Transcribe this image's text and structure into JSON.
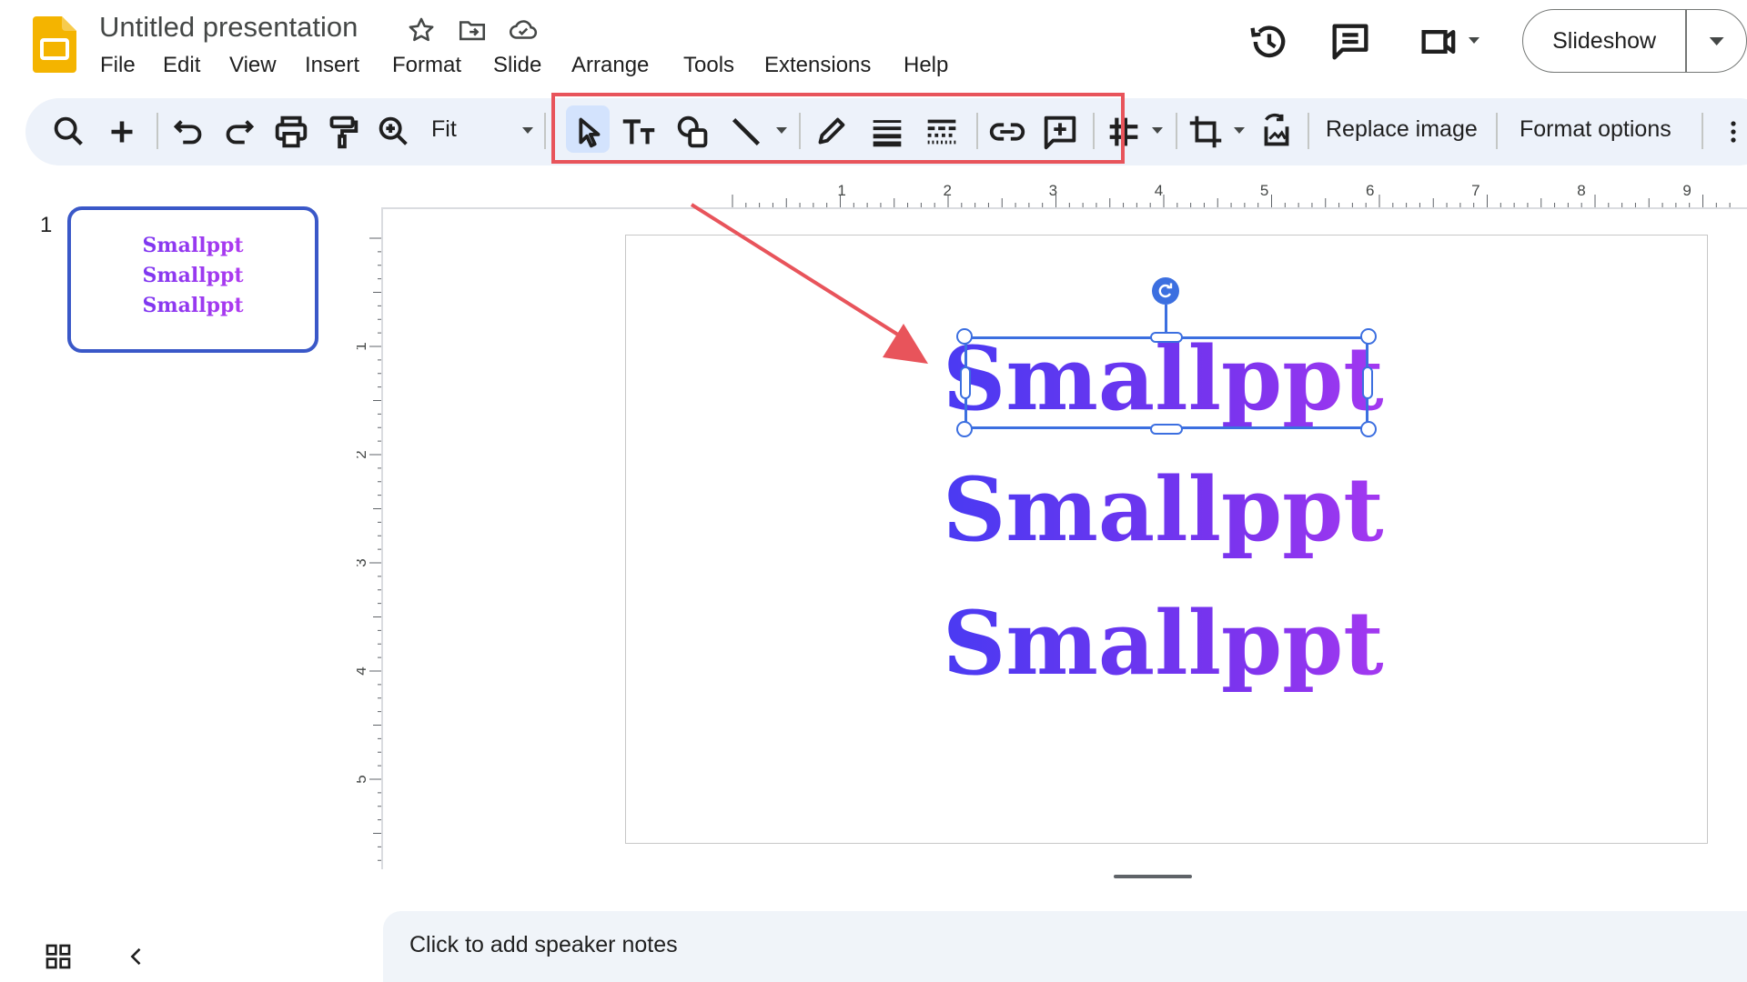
{
  "app": {
    "title": "Untitled presentation",
    "menu": [
      "File",
      "Edit",
      "View",
      "Insert",
      "Format",
      "Slide",
      "Arrange",
      "Tools",
      "Extensions",
      "Help"
    ],
    "slideshow_label": "Slideshow"
  },
  "toolbar": {
    "zoom_value": "Fit",
    "replace_image": "Replace image",
    "format_options": "Format options"
  },
  "filmstrip": {
    "slide_number": "1",
    "thumb_lines": [
      "Smallppt",
      "Smallppt",
      "Smallppt"
    ]
  },
  "ruler": {
    "horizontal": [
      "1",
      "2",
      "3",
      "4",
      "5",
      "6",
      "7",
      "8",
      "9"
    ],
    "vertical": [
      "1",
      "2",
      "3",
      "4",
      "5"
    ]
  },
  "slide": {
    "words": [
      "Smallppt",
      "Smallppt",
      "Smallppt"
    ],
    "selected_index": 0
  },
  "notes": {
    "placeholder": "Click to add speaker notes"
  },
  "colors": {
    "highlight": "#e8545b",
    "selection": "#3c6fe0",
    "gradient_start": "#4a3af2",
    "gradient_end": "#d83df2"
  },
  "icons": [
    "slides-logo-icon",
    "star-icon",
    "move-folder-icon",
    "cloud-saved-icon",
    "history-icon",
    "comments-icon",
    "meet-icon",
    "search-icon",
    "add-icon",
    "undo-icon",
    "redo-icon",
    "print-icon",
    "paint-format-icon",
    "zoom-icon",
    "select-icon",
    "text-box-icon",
    "shape-icon",
    "line-icon",
    "pen-icon",
    "border-weight-icon",
    "border-dash-icon",
    "link-icon",
    "add-comment-icon",
    "mask-icon",
    "crop-icon",
    "reset-image-icon",
    "more-icon",
    "grid-view-icon",
    "collapse-icon"
  ]
}
